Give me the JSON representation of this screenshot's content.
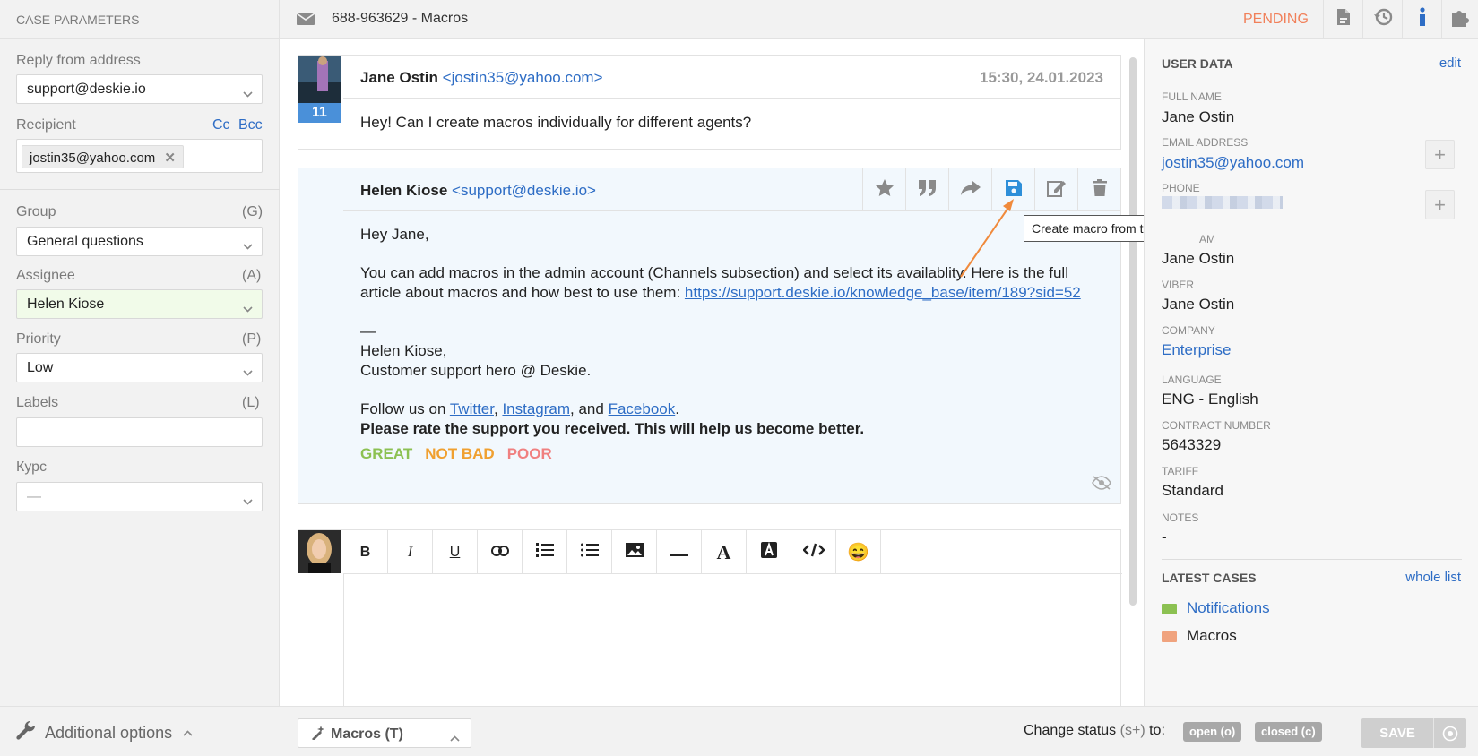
{
  "topbar": {
    "section_title": "CASE PARAMETERS",
    "case_title": "688-963629 - Macros",
    "status": "PENDING"
  },
  "sidebar": {
    "reply_from_label": "Reply from address",
    "reply_from_value": "support@deskie.io",
    "recipient_label": "Recipient",
    "cc": "Cc",
    "bcc": "Bcc",
    "recipient_chip": "jostin35@yahoo.com",
    "group_label": "Group",
    "group_key": "(G)",
    "group_value": "General questions",
    "assignee_label": "Assignee",
    "assignee_key": "(A)",
    "assignee_value": "Helen Kiose",
    "priority_label": "Priority",
    "priority_key": "(P)",
    "priority_value": "Low",
    "labels_label": "Labels",
    "labels_key": "(L)",
    "labels_value": "",
    "kurs_label": "Курс",
    "kurs_value": "—"
  },
  "messages": [
    {
      "avatar_badge": "11",
      "sender": "Jane Ostin",
      "email": "<jostin35@yahoo.com>",
      "timestamp": "15:30, 24.01.2023",
      "body": "Hey! Can I create macros individually for different agents?"
    },
    {
      "sender": "Helen Kiose",
      "email": "<support@deskie.io>",
      "greeting": "Hey Jane,",
      "para1": "You can add macros in the admin account (Channels subsection) and select its availablity. Here is the full article about macros and how best to use them: ",
      "link": "https://support.deskie.io/knowledge_base/item/189?sid=52",
      "dash": "—",
      "sign1": "Helen Kiose,",
      "sign2": "Customer support hero @ Deskie.",
      "follow_prefix": "Follow us on ",
      "twitter": "Twitter",
      "instagram": "Instagram",
      "and": ", and ",
      "facebook": "Facebook",
      "rate_text": "Please rate the support you received. This will help us become better.",
      "great": "GREAT",
      "not_bad": "NOT BAD",
      "poor": "POOR"
    }
  ],
  "tooltip": "Create macro from the text",
  "editor_tools": {
    "bold": "B",
    "italic": "I",
    "underline": "U",
    "font": "A",
    "emoji": "😄"
  },
  "user_data": {
    "header": "USER DATA",
    "edit": "edit",
    "full_name_label": "FULL NAME",
    "full_name": "Jane Ostin",
    "email_label": "EMAIL ADDRESS",
    "email": "jostin35@yahoo.com",
    "phone_label": "PHONE",
    "telegram_label_visible": "AM",
    "telegram": "Jane Ostin",
    "viber_label": "VIBER",
    "viber": "Jane Ostin",
    "company_label": "COMPANY",
    "company": "Enterprise",
    "language_label": "LANGUAGE",
    "language": "ENG - English",
    "contract_label": "CONTRACT NUMBER",
    "contract": "5643329",
    "tariff_label": "TARIFF",
    "tariff": "Standard",
    "notes_label": "NOTES",
    "notes": "-"
  },
  "latest_cases": {
    "header": "LATEST CASES",
    "whole_list": "whole list",
    "items": [
      {
        "title": "Notifications",
        "color": "#8cc152"
      },
      {
        "title": "Macros",
        "color": "#f0a37e"
      }
    ]
  },
  "bottom": {
    "additional_options": "Additional options",
    "macros_button": "Macros (T)",
    "change_status": "Change status",
    "change_status_key": "(s+)",
    "to": "to:",
    "open": "open (o)",
    "closed": "closed (c)",
    "save": "SAVE"
  },
  "colors": {
    "accent": "#2e6dc5",
    "status": "#f1805a",
    "great": "#8cc152",
    "not_bad": "#f0a030",
    "poor": "#f08080",
    "assignee_bg": "#f1fbe9",
    "reply_bg": "#f2f8fd"
  }
}
